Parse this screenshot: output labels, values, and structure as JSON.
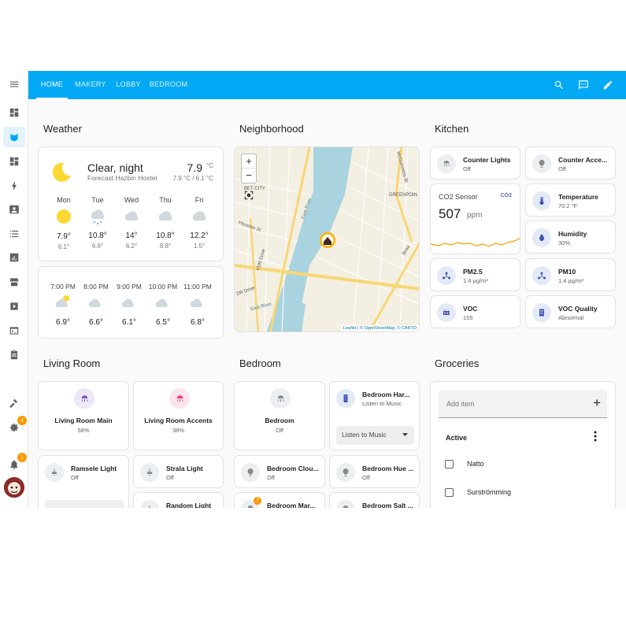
{
  "header": {
    "tabs": [
      "HOME",
      "MAKERY",
      "LOBBY",
      "BEDROOM"
    ],
    "active_tab": "HOME"
  },
  "sidebar": {
    "items": [
      "menu-icon",
      "dashboard-icon",
      "cat-icon",
      "dashboard-icon",
      "lightning-icon",
      "badge-icon",
      "list-icon",
      "chart-icon",
      "store-icon",
      "media-icon",
      "terminal-icon",
      "clipboard-icon",
      "hammer-icon",
      "gear-icon",
      "bell-icon"
    ],
    "settings_badge": "4",
    "notifications_badge": "1"
  },
  "sections": {
    "weather": "Weather",
    "neighborhood": "Neighborhood",
    "kitchen": "Kitchen",
    "living_room": "Living Room",
    "bedroom": "Bedroom",
    "groceries": "Groceries"
  },
  "weather": {
    "condition": "Clear, night",
    "location": "Forecast Hazbin Hostel",
    "temp": "7.9",
    "unit": "°C",
    "range": "7.9 °C / 6.1 °C",
    "daily": [
      {
        "day": "Mon",
        "icon": "sunny",
        "hi": "7.9°",
        "lo": "6.1°"
      },
      {
        "day": "Tue",
        "icon": "rainy",
        "hi": "10.8°",
        "lo": "6.6°"
      },
      {
        "day": "Wed",
        "icon": "cloudy",
        "hi": "14°",
        "lo": "6.2°"
      },
      {
        "day": "Thu",
        "icon": "cloudy",
        "hi": "10.8°",
        "lo": "8.8°"
      },
      {
        "day": "Fri",
        "icon": "cloudy",
        "hi": "12.2°",
        "lo": "1.5°"
      }
    ],
    "hourly": [
      {
        "time": "7:00 PM",
        "icon": "partly-cloudy",
        "temp": "6.9°"
      },
      {
        "time": "8:00 PM",
        "icon": "cloudy",
        "temp": "6.6°"
      },
      {
        "time": "9:00 PM",
        "icon": "cloudy",
        "temp": "6.1°"
      },
      {
        "time": "10:00 PM",
        "icon": "cloudy",
        "temp": "6.5°"
      },
      {
        "time": "11:00 PM",
        "icon": "cloudy",
        "temp": "6.8°"
      }
    ]
  },
  "map": {
    "zoom_in": "+",
    "zoom_out": "−",
    "attribution": "Leaflet | © OpenStreetMap, © CARTO",
    "labels": [
      "BET CITY",
      "McGuinness Bl",
      "GREENPOIN",
      "Houston St",
      "FDR Drive",
      "East River",
      "Broa",
      "DR Drive",
      "East River"
    ]
  },
  "kitchen": {
    "tiles": [
      {
        "name": "Counter Lights",
        "state": "Off",
        "icon": "ceiling-light-icon"
      },
      {
        "name": "Counter Acce...",
        "state": "Off",
        "icon": "bulb-icon"
      },
      {
        "name": "Temperature",
        "state": "70.2 °F",
        "icon": "thermometer-icon"
      },
      {
        "name": "Humidity",
        "state": "30%",
        "icon": "water-drop-icon"
      },
      {
        "name": "PM2.5",
        "state": "1.4 µg/m³",
        "icon": "molecule-icon"
      },
      {
        "name": "PM10",
        "state": "1.4 µg/m³",
        "icon": "molecule-icon"
      },
      {
        "name": "VOC",
        "state": "155",
        "icon": "radiator-icon"
      },
      {
        "name": "VOC Quality",
        "state": "Abnormal",
        "icon": "air-filter-icon"
      }
    ],
    "co2": {
      "name": "CO2 Sensor",
      "value": "507",
      "unit": "ppm",
      "badge": "CO2"
    }
  },
  "living_room": {
    "big": [
      {
        "name": "Living Room Main",
        "state": "58%",
        "color": "#7e57c2",
        "bg": "#ede7f6"
      },
      {
        "name": "Living Room Accents",
        "state": "38%",
        "color": "#ec407a",
        "bg": "#fce4ec"
      }
    ],
    "small": [
      {
        "name": "Ramsele Light",
        "state": "Off"
      },
      {
        "name": "Strala Light",
        "state": "Off"
      },
      {
        "name": "Random Light",
        "state": ""
      }
    ]
  },
  "bedroom": {
    "main": {
      "name": "Bedroom",
      "state": "Off"
    },
    "media": {
      "name": "Bedroom Har...",
      "state": "Listen to Music",
      "select": "Listen to Music"
    },
    "small": [
      {
        "name": "Bedroom Clou...",
        "state": "Off"
      },
      {
        "name": "Bedroom Hue ...",
        "state": "Off"
      },
      {
        "name": "Bedroom Mar...",
        "state": "",
        "badge": "!"
      },
      {
        "name": "Bedroom Salt ...",
        "state": ""
      }
    ]
  },
  "groceries": {
    "placeholder": "Add item",
    "section": "Active",
    "items": [
      "Natto",
      "Surströmming"
    ]
  }
}
